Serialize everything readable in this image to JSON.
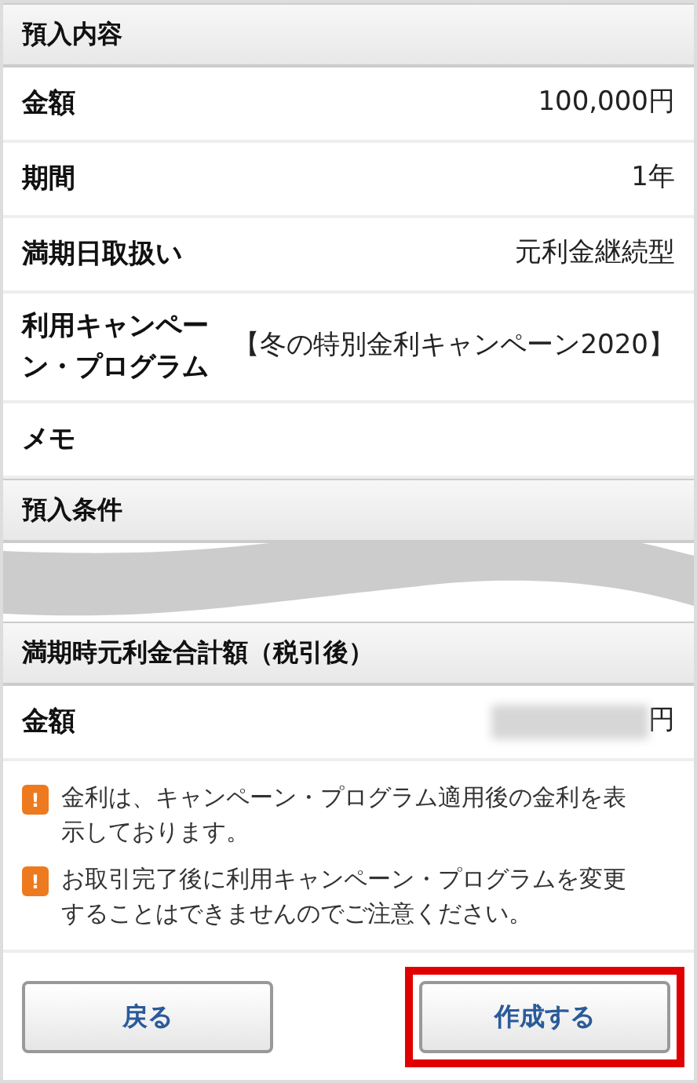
{
  "sections": [
    {
      "title": "預入内容",
      "rows": [
        {
          "label": "金額",
          "value": "100,000円"
        },
        {
          "label": "期間",
          "value": "1年"
        },
        {
          "label": "満期日取扱い",
          "value": "元利金継続型"
        },
        {
          "label": "利用キャンペーン・プログラム",
          "value": "【冬の特別金利キャンペーン2020】"
        },
        {
          "label": "メモ"
        }
      ]
    },
    {
      "title": "預入条件",
      "collapsed": true
    },
    {
      "title": "満期時元利金合計額（税引後）",
      "rows": [
        {
          "label": "金額",
          "value": "円",
          "masked": true
        }
      ]
    }
  ],
  "notes": [
    "金利は、キャンペーン・プログラム適用後の金利を表示しております。",
    "お取引完了後に利用キャンペーン・プログラムを変更することはできませんのでご注意ください。"
  ],
  "notice_icon": "!",
  "buttons": [
    {
      "label": "戻る",
      "highlighted": false
    },
    {
      "label": "作成する",
      "highlighted": true
    }
  ]
}
